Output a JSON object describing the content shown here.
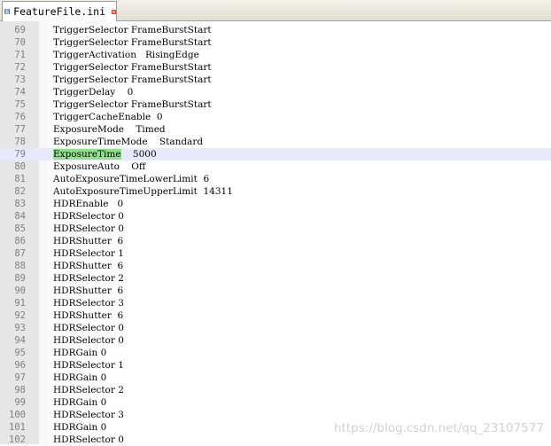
{
  "tab": {
    "label": "FeatureFile.ini"
  },
  "editor": {
    "current_line": 79,
    "highlight_word": "ExposureTime",
    "lines": [
      {
        "n": "69",
        "text": "TriggerSelector FrameBurstStart"
      },
      {
        "n": "70",
        "text": "TriggerSelector FrameBurstStart"
      },
      {
        "n": "71",
        "text": "TriggerActivation   RisingEdge"
      },
      {
        "n": "72",
        "text": "TriggerSelector FrameBurstStart"
      },
      {
        "n": "73",
        "text": "TriggerSelector FrameBurstStart"
      },
      {
        "n": "74",
        "text": "TriggerDelay    0"
      },
      {
        "n": "75",
        "text": "TriggerSelector FrameBurstStart"
      },
      {
        "n": "76",
        "text": "TriggerCacheEnable  0"
      },
      {
        "n": "77",
        "text": "ExposureMode    Timed"
      },
      {
        "n": "78",
        "text": "ExposureTimeMode    Standard"
      },
      {
        "n": "79",
        "text": "ExposureTime    5000"
      },
      {
        "n": "80",
        "text": "ExposureAuto    Off"
      },
      {
        "n": "81",
        "text": "AutoExposureTimeLowerLimit  6"
      },
      {
        "n": "82",
        "text": "AutoExposureTimeUpperLimit  14311"
      },
      {
        "n": "83",
        "text": "HDREnable   0"
      },
      {
        "n": "84",
        "text": "HDRSelector 0"
      },
      {
        "n": "85",
        "text": "HDRSelector 0"
      },
      {
        "n": "86",
        "text": "HDRShutter  6"
      },
      {
        "n": "87",
        "text": "HDRSelector 1"
      },
      {
        "n": "88",
        "text": "HDRShutter  6"
      },
      {
        "n": "89",
        "text": "HDRSelector 2"
      },
      {
        "n": "90",
        "text": "HDRShutter  6"
      },
      {
        "n": "91",
        "text": "HDRSelector 3"
      },
      {
        "n": "92",
        "text": "HDRShutter  6"
      },
      {
        "n": "93",
        "text": "HDRSelector 0"
      },
      {
        "n": "94",
        "text": "HDRSelector 0"
      },
      {
        "n": "95",
        "text": "HDRGain 0"
      },
      {
        "n": "96",
        "text": "HDRSelector 1"
      },
      {
        "n": "97",
        "text": "HDRGain 0"
      },
      {
        "n": "98",
        "text": "HDRSelector 2"
      },
      {
        "n": "99",
        "text": "HDRGain 0"
      },
      {
        "n": "100",
        "text": "HDRSelector 3"
      },
      {
        "n": "101",
        "text": "HDRGain 0"
      },
      {
        "n": "102",
        "text": "HDRSelector 0"
      }
    ]
  },
  "watermark": "https://blog.csdn.net/qq_23107577",
  "colors": {
    "gutter_bg": "#e6e6e6",
    "line_number": "#808080",
    "current_line_bg": "#e8e8ff",
    "word_highlight": "#8ee08a",
    "close_icon": "#e03a2a"
  },
  "icons": {
    "tab_icon": "save-disk-icon",
    "close": "close-icon"
  }
}
